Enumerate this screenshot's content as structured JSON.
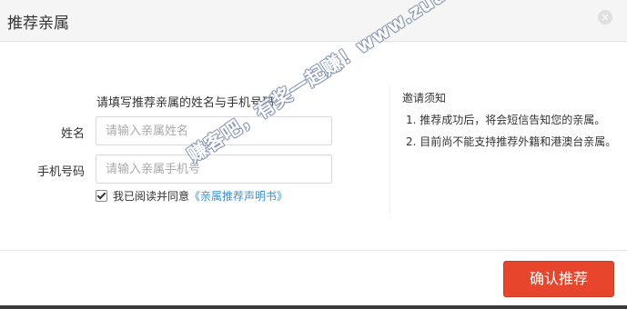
{
  "dialog": {
    "title": "推荐亲属",
    "close_symbol": "×"
  },
  "form": {
    "instruction": "请填写推荐亲属的姓名与手机号码",
    "name_label": "姓名",
    "name_placeholder": "请输入亲属姓名",
    "phone_label": "手机号码",
    "phone_placeholder": "请输入亲属手机号",
    "agree_text": "我已阅读并同意",
    "agree_link": "《亲属推荐声明书》",
    "agree_checked": true
  },
  "notice": {
    "title": "邀请须知",
    "items": [
      "1. 推荐成功后，将会短信告知您的亲属。",
      "2. 目前尚不能支持推荐外籍和港澳台亲属。"
    ]
  },
  "footer": {
    "confirm_label": "确认推荐"
  },
  "watermark": {
    "text": "赚客吧，有奖一起赚！www.zuanke8.com"
  },
  "colors": {
    "accent": "#e8462c",
    "link": "#3f8fd2"
  }
}
